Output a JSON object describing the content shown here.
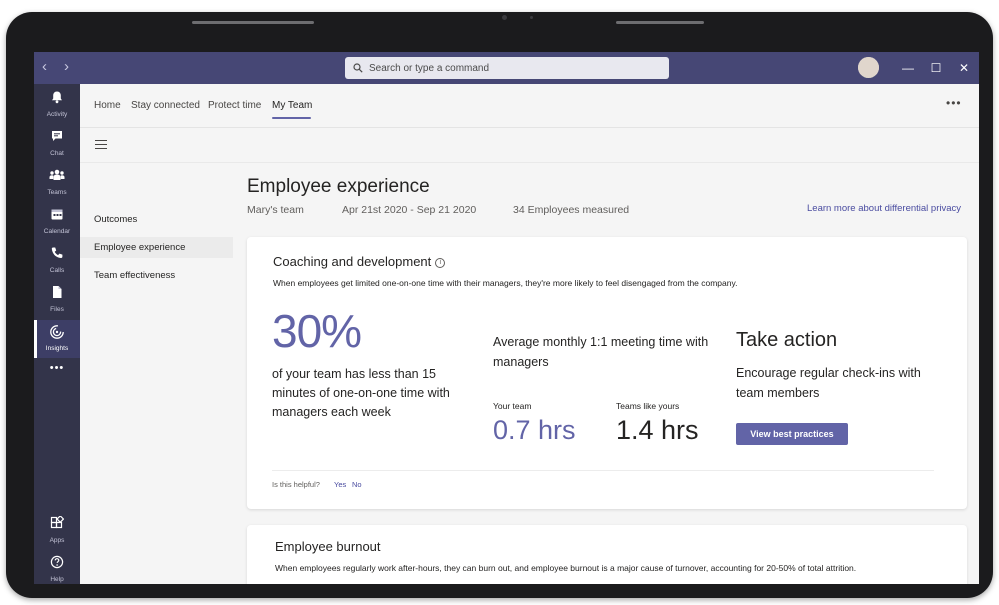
{
  "titlebar": {
    "back": "‹",
    "forward": "›",
    "search_placeholder": "Search or type a command",
    "minimize": "—",
    "maximize": "☐",
    "close": "✕"
  },
  "rail": {
    "items": [
      {
        "label": "Activity",
        "icon": "bell-icon"
      },
      {
        "label": "Chat",
        "icon": "chat-icon"
      },
      {
        "label": "Teams",
        "icon": "teams-icon"
      },
      {
        "label": "Calendar",
        "icon": "calendar-icon"
      },
      {
        "label": "Calls",
        "icon": "phone-icon"
      },
      {
        "label": "Files",
        "icon": "file-icon"
      },
      {
        "label": "Insights",
        "icon": "insights-icon"
      },
      {
        "label": "",
        "icon": "more-icon"
      },
      {
        "label": "Apps",
        "icon": "apps-icon"
      },
      {
        "label": "Help",
        "icon": "help-icon"
      }
    ],
    "more_glyph": "•••"
  },
  "tabs": {
    "items": [
      "Home",
      "Stay connected",
      "Protect time",
      "My Team"
    ],
    "active": "My Team",
    "more_glyph": "•••"
  },
  "sidenav": {
    "items": [
      "Outcomes",
      "Employee experience",
      "Team effectiveness"
    ],
    "active": "Employee experience"
  },
  "main": {
    "title": "Employee experience",
    "team": "Mary's team",
    "date_range": "Apr 21st 2020 - Sep 21 2020",
    "measured": "34 Employees measured",
    "privacy_link": "Learn more about differential privacy"
  },
  "coaching": {
    "title": "Coaching and development",
    "info_glyph": "i",
    "description": "When employees get limited one-on-one time with their managers, they're more likely to feel disengaged from the company.",
    "big_stat": "30%",
    "big_stat_text": "of your team has less than 15 minutes of one-on-one time with managers each week",
    "avg_title": "Average monthly 1:1 meeting time with managers",
    "your_team_label": "Your team",
    "your_team_value": "0.7 hrs",
    "peers_label": "Teams like yours",
    "peers_value": "1.4 hrs",
    "action_title": "Take action",
    "action_text": "Encourage regular check-ins with team members",
    "action_button": "View best practices",
    "helpful_question": "Is this helpful?",
    "helpful_yes": "Yes",
    "helpful_no": "No"
  },
  "burnout": {
    "title": "Employee burnout",
    "description": "When employees regularly work after-hours, they can burn out, and employee burnout is a major cause of turnover, accounting for 20-50% of total attrition."
  },
  "colors": {
    "titlebar": "#464775",
    "rail": "#33344a",
    "accent": "#6264a7",
    "link": "#4a4ca0"
  }
}
